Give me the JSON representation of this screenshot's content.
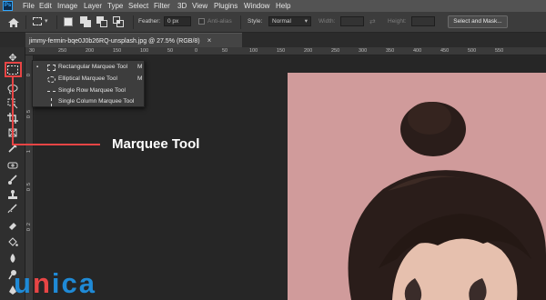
{
  "app": {
    "logo_text": "Ps",
    "menu": [
      "File",
      "Edit",
      "Image",
      "Layer",
      "Type",
      "Select",
      "Filter",
      "3D",
      "View",
      "Plugins",
      "Window",
      "Help"
    ]
  },
  "options_bar": {
    "feather_label": "Feather:",
    "feather_value": "0 px",
    "antialias_label": "Anti-alias",
    "style_label": "Style:",
    "style_value": "Normal",
    "width_label": "Width:",
    "height_label": "Height:",
    "select_mask_label": "Select and Mask..."
  },
  "document_tab": {
    "title": "jimmy-fermin-bqe0J0b26RQ-unsplash.jpg @ 27.5% (RGB/8)",
    "close": "×"
  },
  "rulers": {
    "top": [
      "30",
      "250",
      "200",
      "150",
      "100",
      "50",
      "0",
      "50",
      "100",
      "150",
      "200",
      "250",
      "300",
      "350",
      "400",
      "450",
      "500",
      "550"
    ],
    "left": [
      "0",
      "5",
      "0",
      "1",
      "5",
      "0",
      "2",
      "0"
    ]
  },
  "toolbar": {
    "tools": [
      "move-icon",
      "rectangular-marquee-icon",
      "lasso-icon",
      "object-select-icon",
      "crop-icon",
      "frame-icon",
      "eyedropper-icon",
      "spot-healing-icon",
      "brush-icon",
      "clone-stamp-icon",
      "history-brush-icon",
      "eraser-icon",
      "paint-bucket-icon",
      "blur-icon",
      "dodge-icon",
      "pen-icon"
    ]
  },
  "flyout": {
    "items": [
      {
        "label": "Rectangular Marquee Tool",
        "shortcut": "M",
        "active": true
      },
      {
        "label": "Elliptical Marquee Tool",
        "shortcut": "M",
        "active": false
      },
      {
        "label": "Single Row Marquee Tool",
        "shortcut": "",
        "active": false
      },
      {
        "label": "Single Column Marquee Tool",
        "shortcut": "",
        "active": false
      }
    ],
    "bullet": "▪"
  },
  "annotation": {
    "callout": "Marquee Tool",
    "color": "#e84545"
  },
  "watermark": {
    "letters": [
      "u",
      "n",
      "i",
      "c",
      "a"
    ],
    "colors": [
      "#1f8ad6",
      "#e84545",
      "#1f8ad6",
      "#1f8ad6",
      "#1f8ad6"
    ]
  },
  "colors": {
    "ps_blue": "#31a8ff",
    "photo_background": "#d09b9b",
    "hair": "#2a1d1a"
  }
}
